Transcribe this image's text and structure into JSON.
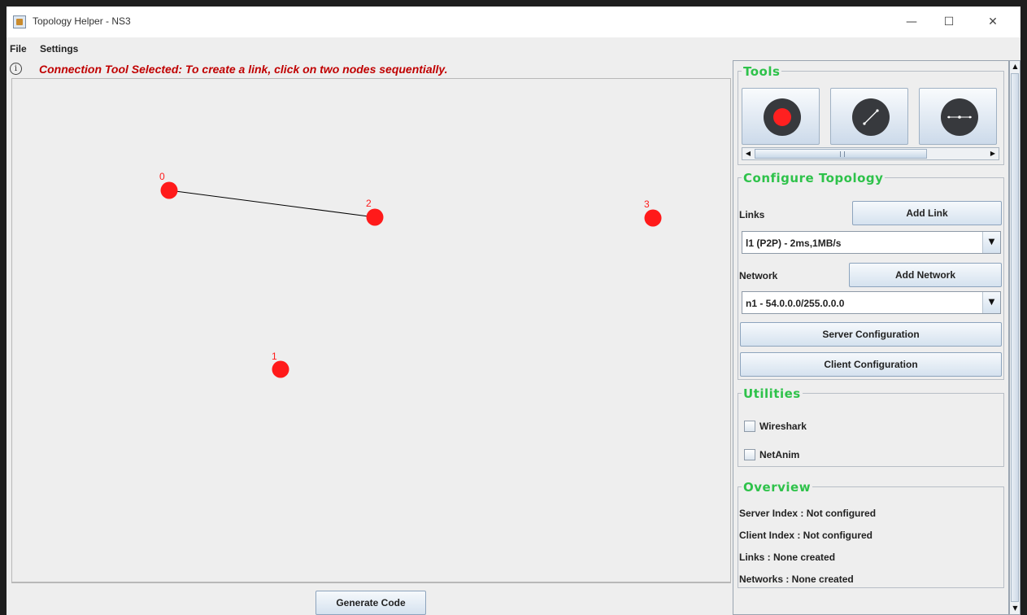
{
  "window": {
    "title": "Topology Helper - NS3",
    "minimize_glyph": "—",
    "maximize_glyph": "☐",
    "close_glyph": "✕"
  },
  "menu": {
    "items": [
      "File",
      "Settings"
    ]
  },
  "status": {
    "info_glyph": "i",
    "message": "Connection Tool Selected: To create a link, click on two nodes sequentially."
  },
  "canvas": {
    "node_color": "#ff1a1a",
    "link_color": "#000000",
    "nodes": [
      {
        "label": "0"
      },
      {
        "label": "2"
      },
      {
        "label": "3"
      },
      {
        "label": "1"
      }
    ],
    "links": [
      {
        "from": "0",
        "to": "2"
      }
    ]
  },
  "bottom": {
    "generate_label": "Generate Code"
  },
  "tools": {
    "title": "Tools",
    "buttons": [
      {
        "icon": "record-node-icon"
      },
      {
        "icon": "connection-tool-icon"
      },
      {
        "icon": "network-bus-icon"
      }
    ],
    "scroll_left": "◀",
    "scroll_right": "▶"
  },
  "configure": {
    "title": "Configure Topology",
    "links_label": "Links",
    "add_link_label": "Add Link",
    "links_selected": "l1 (P2P) - 2ms,1MB/s",
    "network_label": "Network",
    "add_network_label": "Add Network",
    "network_selected": "n1 - 54.0.0.0/255.0.0.0",
    "server_config_label": "Server Configuration",
    "client_config_label": "Client Configuration",
    "combo_arrow": "▼"
  },
  "utilities": {
    "title": "Utilities",
    "wireshark_label": "Wireshark",
    "wireshark_checked": false,
    "netanim_label": "NetAnim",
    "netanim_checked": false
  },
  "overview": {
    "title": "Overview",
    "server_index": "Server Index :  Not configured",
    "client_index": "Client Index  : Not configured",
    "links": "Links :  None created",
    "networks": "Networks : None created"
  },
  "scrollbar": {
    "up": "▲",
    "down": "▼"
  }
}
